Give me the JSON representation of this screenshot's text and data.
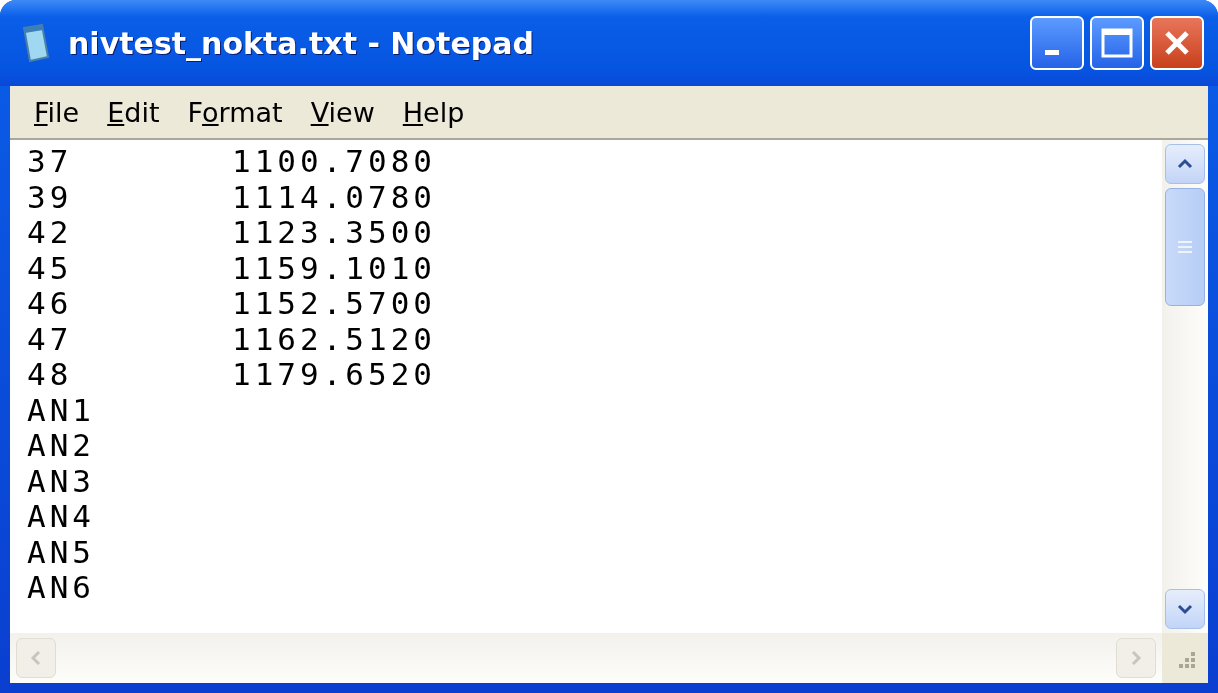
{
  "window": {
    "title": "nivtest_nokta.txt - Notepad"
  },
  "menu": [
    {
      "key": "F",
      "after": "ile"
    },
    {
      "key": "E",
      "after": "dit"
    },
    {
      "before": "F",
      "key": "o",
      "after": "rmat"
    },
    {
      "key": "V",
      "after": "iew"
    },
    {
      "key": "H",
      "after": "elp"
    }
  ],
  "lines": [
    {
      "column_1": "37",
      "column_2": "1100.7080"
    },
    {
      "column_1": "39",
      "column_2": "1114.0780"
    },
    {
      "column_1": "42",
      "column_2": "1123.3500"
    },
    {
      "column_1": "45",
      "column_2": "1159.1010"
    },
    {
      "column_1": "46",
      "column_2": "1152.5700"
    },
    {
      "column_1": "47",
      "column_2": "1162.5120"
    },
    {
      "column_1": "48",
      "column_2": "1179.6520"
    },
    {
      "column_1": "AN1"
    },
    {
      "column_1": "AN2"
    },
    {
      "column_1": "AN3"
    },
    {
      "column_1": "AN4"
    },
    {
      "column_1": "AN5"
    },
    {
      "column_1": "AN6"
    }
  ]
}
